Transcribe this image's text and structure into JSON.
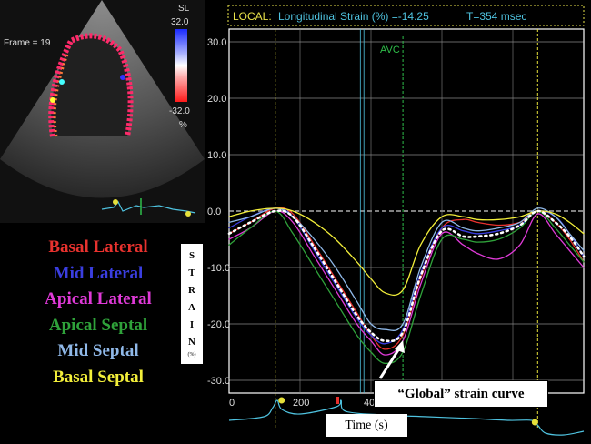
{
  "echo": {
    "frame_label": "Frame = 19",
    "colorbar": {
      "title": "SL",
      "top": "32.0",
      "bottom": "-32.0",
      "unit": "%"
    }
  },
  "legend": [
    {
      "label": "Basal Lateral",
      "color": "#e8322e"
    },
    {
      "label": "Mid Lateral",
      "color": "#3a3ee0"
    },
    {
      "label": "Apical Lateral",
      "color": "#e03ad8"
    },
    {
      "label": "Apical Septal",
      "color": "#2fa23a"
    },
    {
      "label": "Mid Septal",
      "color": "#8fb8e8"
    },
    {
      "label": "Basal Septal",
      "color": "#f2ee3a"
    }
  ],
  "strain_box": {
    "letters": [
      "S",
      "T",
      "R",
      "A",
      "I",
      "N"
    ],
    "unit": "(%)"
  },
  "header": {
    "local_label": "LOCAL:",
    "text": "Longitudinal Strain (%) =-14.25",
    "time": "T=354 msec"
  },
  "avc_label": "AVC",
  "time_label": "Time  (s)",
  "global_label": "“Global” strain curve",
  "colors": {
    "axis": "#ffffff",
    "grid": "#cccccc",
    "header": "#e9e24a",
    "cyan": "#4fc3e0",
    "avc": "#2fbf4a",
    "marker": "#e6e03a",
    "global": "#ffffff"
  },
  "chart_data": {
    "type": "line",
    "title": "Longitudinal Strain (%) =-14.25",
    "ylabel": "STRAIN (%)",
    "xlabel": "Time  (s)",
    "ylim": [
      -32,
      33
    ],
    "xlim": [
      0,
      1000
    ],
    "y_ticks": [
      "30.0",
      "20.0",
      "10.0",
      "0.0",
      "-10.0",
      "-20.0",
      "-30.0"
    ],
    "y_tick_values": [
      30,
      20,
      10,
      0,
      -10,
      -20,
      -30
    ],
    "x_ticks": [
      "0",
      "200",
      "400"
    ],
    "x_tick_values": [
      0,
      200,
      400
    ],
    "avc_time": 490,
    "markers_time": [
      130,
      870
    ],
    "x": [
      0,
      60,
      130,
      180,
      240,
      300,
      360,
      400,
      440,
      490,
      540,
      600,
      660,
      700,
      760,
      820,
      870,
      920,
      960,
      1000
    ],
    "series": [
      {
        "name": "Basal Lateral",
        "values": [
          -4,
          -2,
          0.5,
          -0.5,
          -6,
          -12,
          -18,
          -22,
          -24.5,
          -22,
          -12,
          -3,
          -1.5,
          -2,
          -2.5,
          -2,
          0,
          -2,
          -5,
          -9
        ]
      },
      {
        "name": "Mid Lateral",
        "values": [
          -3,
          -1,
          0.5,
          -1,
          -7,
          -13,
          -19,
          -22,
          -23.5,
          -21,
          -11,
          -3,
          -3.5,
          -4,
          -3.5,
          -2.5,
          0,
          -1,
          -4,
          -8
        ]
      },
      {
        "name": "Apical Lateral",
        "values": [
          -5,
          -3,
          0,
          -2,
          -8,
          -14,
          -20,
          -23,
          -25.5,
          -23,
          -13,
          -4,
          -6,
          -7.5,
          -8.5,
          -6,
          -0.5,
          -4,
          -7,
          -10
        ]
      },
      {
        "name": "Apical Septal",
        "values": [
          -6,
          -3,
          0,
          -4,
          -10,
          -16,
          -22,
          -25,
          -27,
          -25,
          -15,
          -5,
          -5,
          -5.5,
          -5,
          -3,
          0,
          -3,
          -6,
          -9
        ]
      },
      {
        "name": "Mid Septal",
        "values": [
          -2,
          -1,
          0.5,
          -1,
          -5,
          -10,
          -16,
          -20,
          -21,
          -20,
          -10,
          -2,
          -3,
          -3.5,
          -3,
          -2,
          0.5,
          -1,
          -4,
          -7
        ]
      },
      {
        "name": "Basal Septal",
        "values": [
          -1,
          0,
          0.5,
          0,
          -2,
          -5,
          -9,
          -12,
          -14.5,
          -14,
          -6,
          -1,
          -1,
          -1.5,
          -1.5,
          -1,
          0,
          -0.5,
          -2,
          -4
        ]
      },
      {
        "name": "“Global” strain curve",
        "values": [
          -4,
          -2,
          0,
          -1,
          -6.5,
          -12.5,
          -18.5,
          -21.5,
          -23,
          -21.5,
          -11.5,
          -3.5,
          -4.5,
          -4.5,
          -4,
          -2.5,
          0,
          -2,
          -4.5,
          -8
        ]
      }
    ]
  }
}
